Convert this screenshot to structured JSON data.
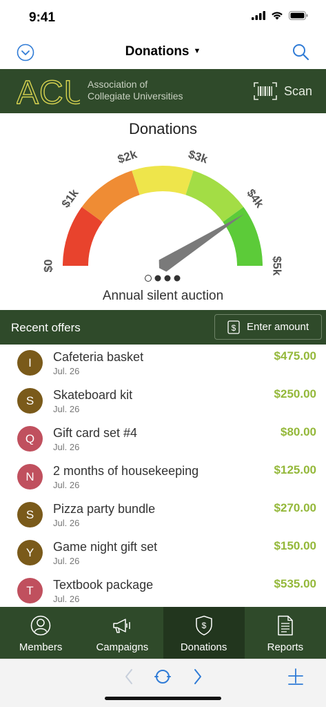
{
  "status": {
    "time": "9:41"
  },
  "nav": {
    "title": "Donations"
  },
  "org": {
    "logo_text": "ACU",
    "name_line1": "Association of",
    "name_line2": "Collegiate Universities",
    "scan_label": "Scan"
  },
  "gauge": {
    "title": "Donations",
    "subtitle": "Annual silent auction",
    "min": 0,
    "max": 5000,
    "value": 4100,
    "tick_labels": [
      "$0",
      "$1k",
      "$2k",
      "$3k",
      "$4k",
      "$5k"
    ],
    "segment_colors": [
      "#e8432d",
      "#ef8c34",
      "#eee54b",
      "#a3dd45",
      "#5ccb39"
    ],
    "pager": {
      "total": 4,
      "active": 0
    }
  },
  "offers": {
    "title": "Recent offers",
    "enter_label": "Enter amount",
    "items": [
      {
        "initial": "I",
        "name": "Cafeteria basket",
        "date": "Jul. 26",
        "amount": "$475.00",
        "color": "#7a5a1a"
      },
      {
        "initial": "S",
        "name": "Skateboard kit",
        "date": "Jul. 26",
        "amount": "$250.00",
        "color": "#7a5a1a"
      },
      {
        "initial": "Q",
        "name": "Gift card set #4",
        "date": "Jul. 26",
        "amount": "$80.00",
        "color": "#c0505e"
      },
      {
        "initial": "N",
        "name": "2 months of housekeeping",
        "date": "Jul. 26",
        "amount": "$125.00",
        "color": "#c0505e"
      },
      {
        "initial": "S",
        "name": "Pizza party bundle",
        "date": "Jul. 26",
        "amount": "$270.00",
        "color": "#7a5a1a"
      },
      {
        "initial": "Y",
        "name": "Game night gift set",
        "date": "Jul. 26",
        "amount": "$150.00",
        "color": "#7a5a1a"
      },
      {
        "initial": "T",
        "name": "Textbook package",
        "date": "Jul. 26",
        "amount": "$535.00",
        "color": "#c0505e"
      }
    ]
  },
  "tabs": [
    {
      "label": "Members",
      "icon": "person-icon"
    },
    {
      "label": "Campaigns",
      "icon": "megaphone-icon"
    },
    {
      "label": "Donations",
      "icon": "shield-dollar-icon",
      "active": true
    },
    {
      "label": "Reports",
      "icon": "document-icon"
    }
  ],
  "colors": {
    "brand": "#2f4a2a",
    "accent": "#2f7bd6",
    "amount": "#94b83a"
  }
}
